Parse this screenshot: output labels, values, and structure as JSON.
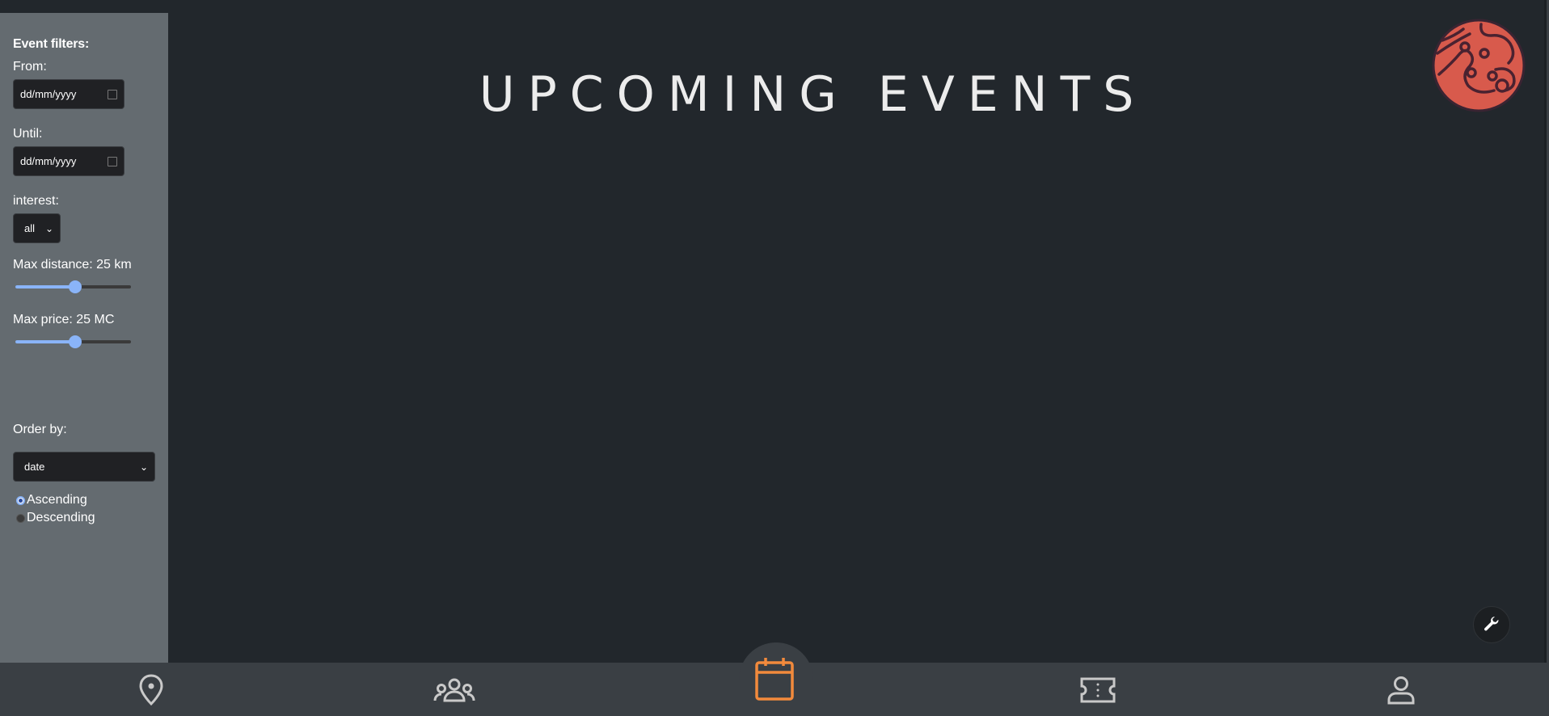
{
  "filters": {
    "title": "Event filters:",
    "from": {
      "label": "From:",
      "placeholder": "dd/mm/yyyy"
    },
    "until": {
      "label": "Until:",
      "placeholder": "dd/mm/yyyy"
    },
    "interest": {
      "label": "interest:",
      "value": "all"
    },
    "max_distance": {
      "label": "Max distance: 25 km",
      "value": 25,
      "fraction": 0.52
    },
    "max_price": {
      "label": "Max price: 25 MC",
      "value": 25,
      "fraction": 0.52
    },
    "order_by": {
      "label": "Order by:",
      "value": "date"
    },
    "sort": {
      "ascending": "Ascending",
      "descending": "Descending",
      "selected": "ascending"
    }
  },
  "header": {
    "title": "UPCOMING EVENTS"
  },
  "nav": {
    "items": [
      {
        "icon": "map-pin-icon"
      },
      {
        "icon": "group-icon"
      },
      {
        "icon": "calendar-icon",
        "active": true
      },
      {
        "icon": "ticket-icon"
      },
      {
        "icon": "user-icon"
      }
    ]
  },
  "colors": {
    "accent": "#f28a3c",
    "slider": "#8ab4f8",
    "logo": "#d85a4c",
    "sidebar": "#646b70",
    "background": "#22272c"
  }
}
